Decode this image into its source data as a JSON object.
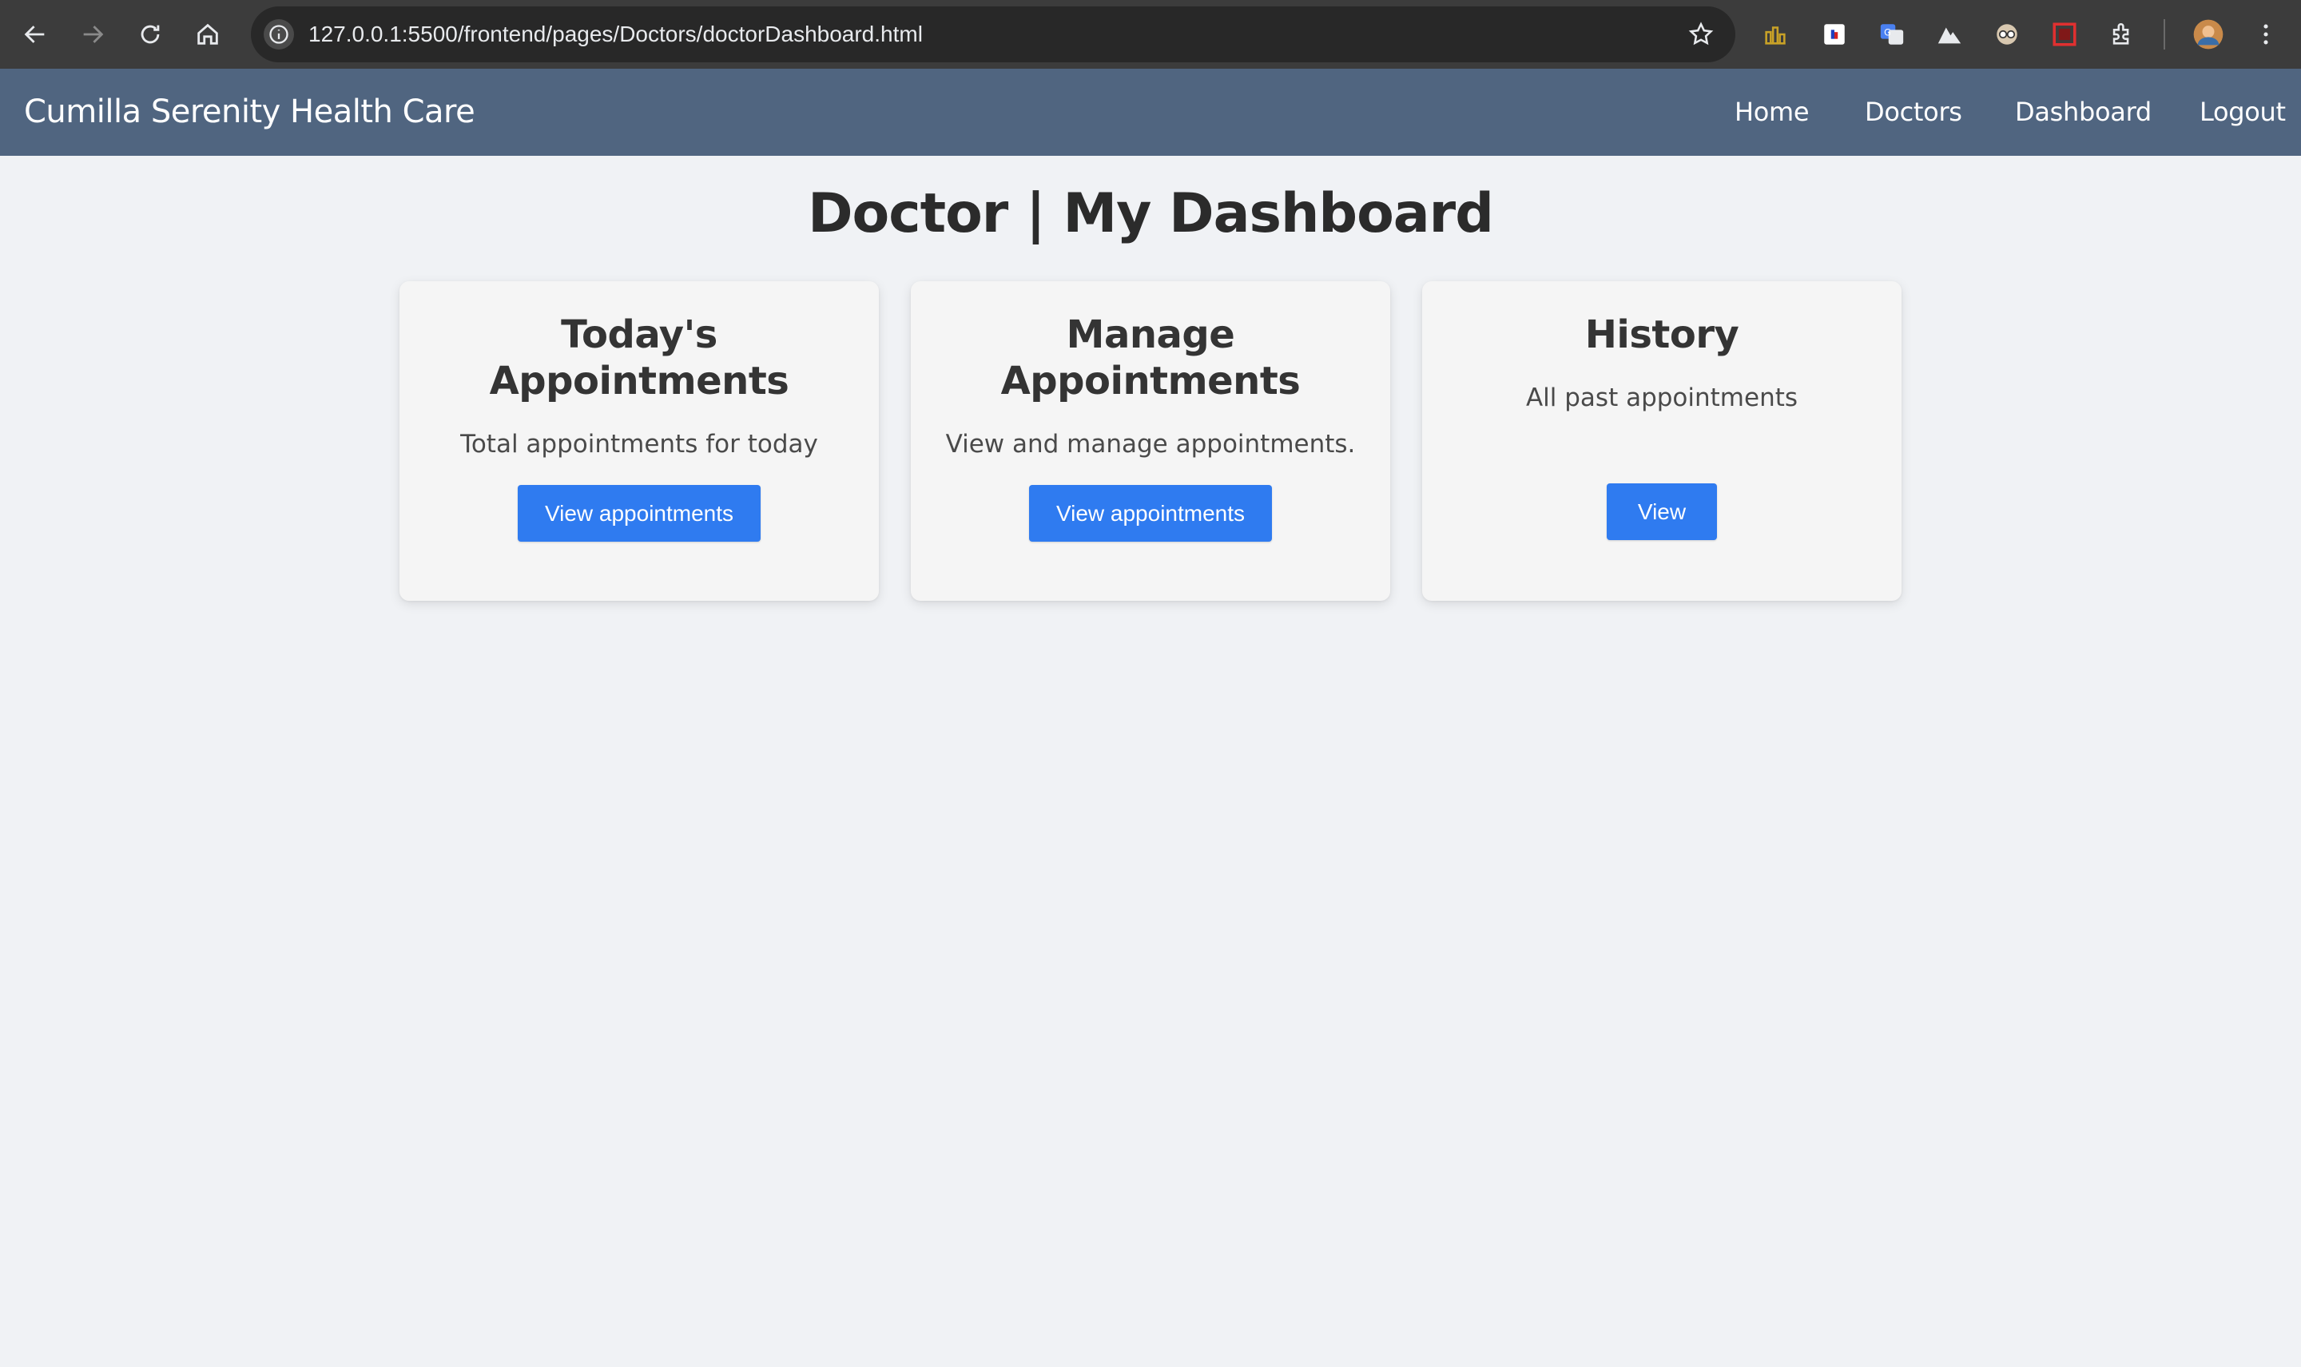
{
  "browser": {
    "url": "127.0.0.1:5500/frontend/pages/Doctors/doctorDashboard.html",
    "icons": [
      "back-icon",
      "forward-icon",
      "reload-icon",
      "home-icon",
      "site-info-icon",
      "bookmark-star-icon",
      "extensions-icon",
      "profile-avatar",
      "menu-kebab-icon"
    ]
  },
  "header": {
    "brand": "Cumilla Serenity Health Care",
    "nav": {
      "home": "Home",
      "doctors": "Doctors",
      "dashboard": "Dashboard",
      "logout": "Logout"
    },
    "bg_color": "#506580"
  },
  "main": {
    "title": "Doctor | My Dashboard",
    "cards": {
      "today": {
        "title": "Today's Appointments",
        "description": "Total appointments for today",
        "button": "View appointments"
      },
      "manage": {
        "title": "Manage Appointments",
        "description": "View and manage appointments.",
        "button": "View appointments"
      },
      "history": {
        "title": "History",
        "description": "All past appointments",
        "button": "View"
      }
    },
    "button_color": "#2f7bf0"
  }
}
